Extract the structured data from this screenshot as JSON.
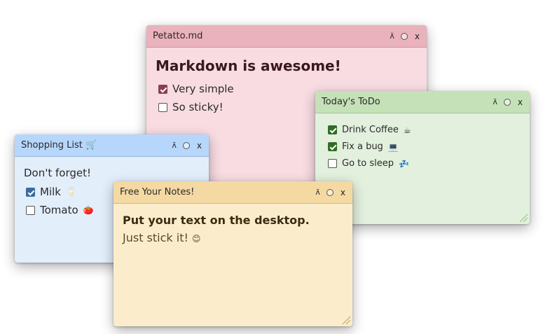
{
  "colors": {
    "pink_title": "#eab2bc",
    "pink_body": "#f8dce2",
    "green_title": "#c5e1b7",
    "green_body": "#e3f0dd",
    "blue_title": "#b7d6fb",
    "blue_body": "#e3eefb",
    "yellow_title": "#f4d9a3",
    "yellow_body": "#fbedcb"
  },
  "controls": {
    "pin_glyph": "ʌ̄",
    "close_glyph": "x"
  },
  "notes": {
    "md": {
      "title": "Petatto.md",
      "heading": "Markdown is awesome!",
      "tasks": [
        {
          "label": "Very simple",
          "checked": true
        },
        {
          "label": "So sticky!",
          "checked": false
        }
      ]
    },
    "todo": {
      "title": "Today's ToDo",
      "tasks": [
        {
          "label": "Drink Coffee",
          "emoji": "☕",
          "checked": true
        },
        {
          "label": "Fix a bug",
          "emoji": "💻",
          "checked": true
        },
        {
          "label": "Go to sleep",
          "emoji": "💤",
          "checked": false
        }
      ]
    },
    "shop": {
      "title": "Shopping List 🛒",
      "text": "Don't forget!",
      "tasks": [
        {
          "label": "Milk",
          "emoji": "🥛",
          "checked": true
        },
        {
          "label": "Tomato",
          "emoji": "🍅",
          "checked": false
        }
      ]
    },
    "free": {
      "title": "Free Your Notes!",
      "heading": "Put your text on the desktop.",
      "text": "Just stick it!",
      "emoji": "😊"
    }
  }
}
